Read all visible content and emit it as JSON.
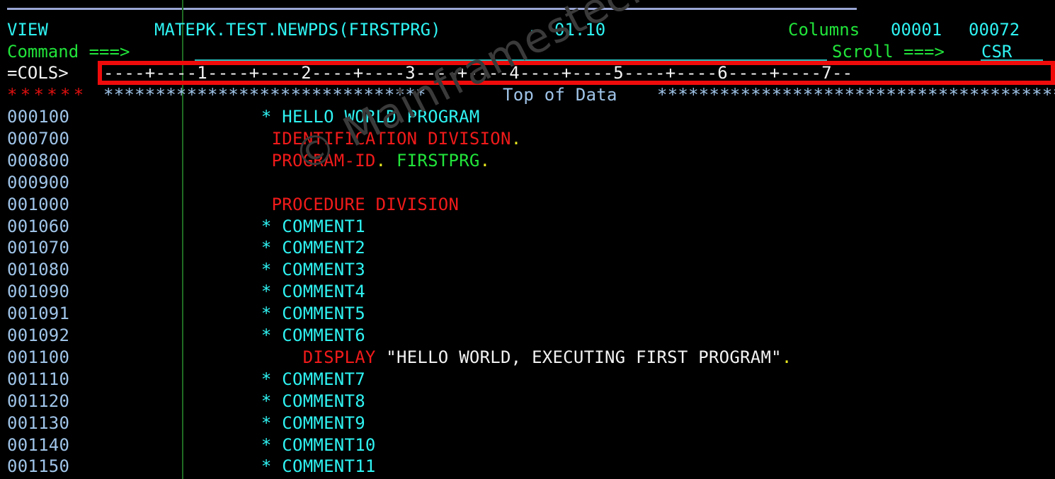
{
  "terminal": {
    "application": "ISPF Editor",
    "background_color": "#000000",
    "colors": {
      "cyan": "#26e0e0",
      "green": "#00e03c",
      "red": "#f11a1a",
      "white": "#f2f2f2",
      "steel_blue": "#9fc4e8",
      "yellow": "#e8e820",
      "highlight_box": "#f00b0b",
      "gutter_divider": "#1f6b23",
      "field_underline": "#2bbcbc",
      "top_rule": "#9aa6d4",
      "watermark": "#3a3a3a"
    }
  },
  "header": {
    "mode_label": "VIEW",
    "dataset_name": "MATEPK.TEST.NEWPDS(FIRSTPRG)",
    "dash": "-",
    "version": "01.10",
    "columns_label": "Columns",
    "columns_from": "00001",
    "columns_to": "00072"
  },
  "command_line": {
    "label": "Command ===>",
    "value": "",
    "placeholder": ""
  },
  "scroll_field": {
    "label": "Scroll ===>",
    "value": "CSR"
  },
  "cols_ruler": {
    "label": "=COLS>",
    "ruler": "----+----1----+----2----+----3----+----4----+----5----+----6----+----7--"
  },
  "top_of_data": {
    "gutter_marker": "******",
    "left_stars": "*******************************",
    "text": "Top of Data",
    "right_stars": "********************************************"
  },
  "watermark": {
    "text": "© Mainframestechhelp"
  },
  "lines": [
    {
      "num": "000100",
      "segments": [
        {
          "text": "       * HELLO WORLD PROGRAM",
          "color": "cyan"
        }
      ]
    },
    {
      "num": "000700",
      "segments": [
        {
          "text": "        IDENTIFICATION DIVISION",
          "color": "red"
        },
        {
          "text": ".",
          "color": "yellow"
        }
      ]
    },
    {
      "num": "000800",
      "segments": [
        {
          "text": "        PROGRAM-ID",
          "color": "red"
        },
        {
          "text": ".",
          "color": "yellow"
        },
        {
          "text": " ",
          "color": "white"
        },
        {
          "text": "FIRSTPRG",
          "color": "green"
        },
        {
          "text": ".",
          "color": "yellow"
        }
      ]
    },
    {
      "num": "000900",
      "segments": [
        {
          "text": "",
          "color": "white"
        }
      ]
    },
    {
      "num": "001000",
      "segments": [
        {
          "text": "        PROCEDURE DIVISION",
          "color": "red"
        }
      ]
    },
    {
      "num": "001060",
      "segments": [
        {
          "text": "       * COMMENT1",
          "color": "cyan"
        }
      ]
    },
    {
      "num": "001070",
      "segments": [
        {
          "text": "       * COMMENT2",
          "color": "cyan"
        }
      ]
    },
    {
      "num": "001080",
      "segments": [
        {
          "text": "       * COMMENT3",
          "color": "cyan"
        }
      ]
    },
    {
      "num": "001090",
      "segments": [
        {
          "text": "       * COMMENT4",
          "color": "cyan"
        }
      ]
    },
    {
      "num": "001091",
      "segments": [
        {
          "text": "       * COMMENT5",
          "color": "cyan"
        }
      ]
    },
    {
      "num": "001092",
      "segments": [
        {
          "text": "       * COMMENT6",
          "color": "cyan"
        }
      ]
    },
    {
      "num": "001100",
      "segments": [
        {
          "text": "           DISPLAY",
          "color": "red"
        },
        {
          "text": " \"HELLO WORLD, EXECUTING FIRST PROGRAM\"",
          "color": "white"
        },
        {
          "text": ".",
          "color": "yellow"
        }
      ]
    },
    {
      "num": "001110",
      "segments": [
        {
          "text": "       * COMMENT7",
          "color": "cyan"
        }
      ]
    },
    {
      "num": "001120",
      "segments": [
        {
          "text": "       * COMMENT8",
          "color": "cyan"
        }
      ]
    },
    {
      "num": "001130",
      "segments": [
        {
          "text": "       * COMMENT9",
          "color": "cyan"
        }
      ]
    },
    {
      "num": "001140",
      "segments": [
        {
          "text": "       * COMMENT10",
          "color": "cyan"
        }
      ]
    },
    {
      "num": "001150",
      "segments": [
        {
          "text": "       * COMMENT11",
          "color": "cyan"
        }
      ]
    }
  ]
}
